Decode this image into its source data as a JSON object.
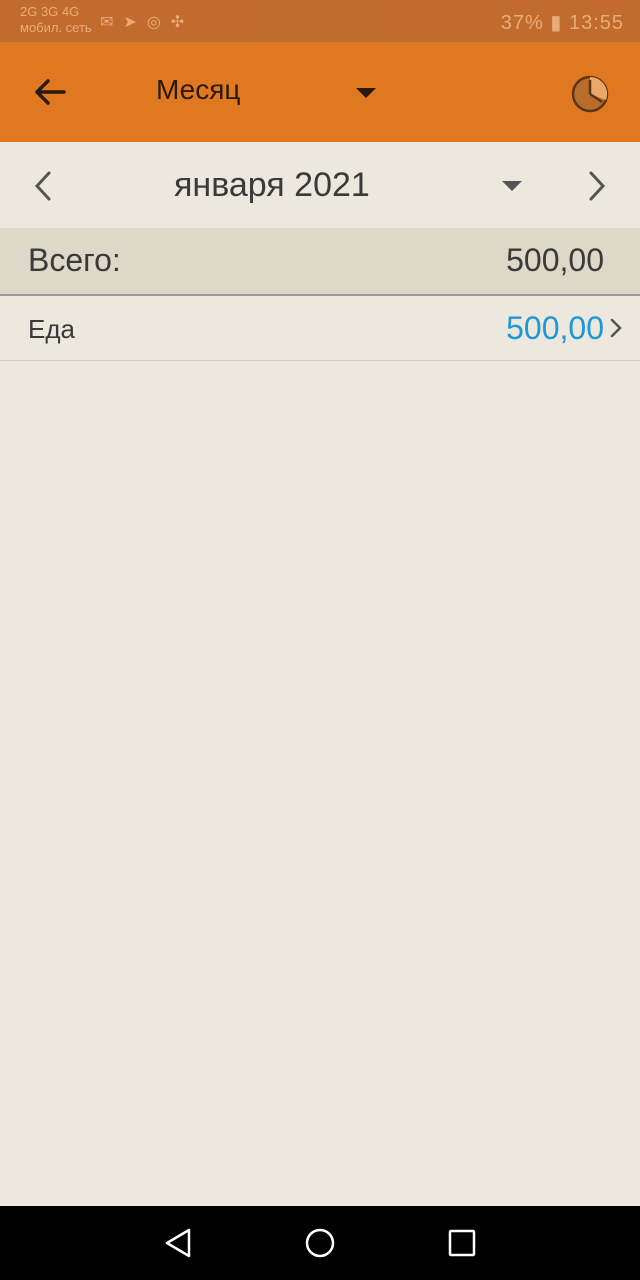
{
  "status_bar": {
    "left_line1": "2G  3G  4G",
    "left_line2": "мобил. сеть",
    "right_text": "37% ▮ 13:55"
  },
  "app_bar": {
    "period_title": "Месяц",
    "back_icon": "arrow-left-icon",
    "clock_icon": "clock-icon",
    "background": "#e07822"
  },
  "date_selector": {
    "label": "января 2021"
  },
  "summary": {
    "total_label": "Всего:",
    "total_value": "500,00"
  },
  "categories": [
    {
      "label": "Еда",
      "value": "500,00",
      "value_color": "#1e98d6"
    }
  ],
  "nav_bar": {
    "back_icon": "triangle-back-icon",
    "home_icon": "circle-home-icon",
    "recents_icon": "square-recents-icon"
  }
}
